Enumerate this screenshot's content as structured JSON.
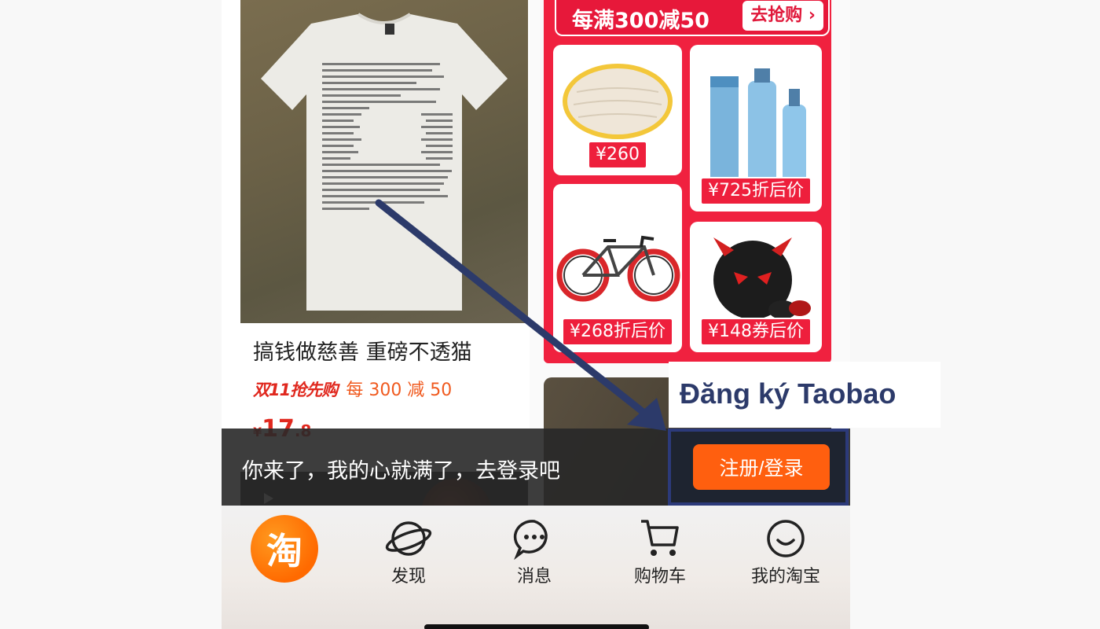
{
  "feed": {
    "left_card": {
      "title": "搞钱做慈善 重磅不透猫",
      "promo_tag": "双11抢先购",
      "promo_text": "每 300 减 50",
      "price_currency": "¥",
      "price_int": "17",
      "price_dec": ".8"
    },
    "promo_block": {
      "header_text": "每满300减50",
      "grab_button": "去抢购",
      "tiles": [
        {
          "price": "¥260"
        },
        {
          "price": "¥725折后价"
        },
        {
          "price": "¥268折后价"
        },
        {
          "price": "¥148券后价"
        }
      ]
    }
  },
  "login_banner": {
    "message": "你来了，我的心就满了，去登录吧",
    "button_label": "注册/登录"
  },
  "tab_bar": {
    "home_logo": "淘",
    "tabs": [
      {
        "label": "发现",
        "icon": "planet-icon"
      },
      {
        "label": "消息",
        "icon": "chat-bubble-icon"
      },
      {
        "label": "购物车",
        "icon": "cart-icon"
      },
      {
        "label": "我的淘宝",
        "icon": "smile-icon"
      }
    ]
  },
  "annotation": {
    "label": "Đăng ký Taobao",
    "color": "#2c3a6a"
  }
}
